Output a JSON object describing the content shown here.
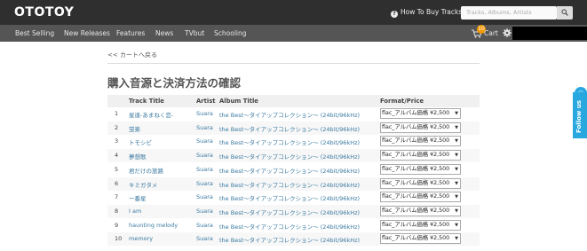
{
  "header": {
    "logo": "OTOTOY",
    "how_to_buy": "How To Buy Tracks",
    "search_placeholder": "Tracks, Albums, Artists"
  },
  "nav": {
    "items": [
      "Best Selling",
      "New Releases",
      "Features",
      "News",
      "TVbut",
      "Schooling"
    ],
    "cart_count": "10",
    "cart_label": "Cart"
  },
  "page": {
    "back_link": "<< カートへ戻る",
    "title": "購入音源と決済方法の確認"
  },
  "table": {
    "headers": {
      "track": "Track Title",
      "artist": "Artist",
      "album": "Album Title",
      "format": "Format/Price"
    },
    "rows": [
      {
        "num": "1",
        "title": "星達-あまねく恋-",
        "artist": "Suara",
        "album": "the Best〜タイアップコレクション〜 (24bit/96kHz)",
        "format": "flac_アルバム価格 ¥2,500"
      },
      {
        "num": "2",
        "title": "蛍楽",
        "artist": "Suara",
        "album": "the Best〜タイアップコレクション〜 (24bit/96kHz)",
        "format": "flac_アルバム価格 ¥2,500"
      },
      {
        "num": "3",
        "title": "トモシビ",
        "artist": "Suara",
        "album": "the Best〜タイアップコレクション〜 (24bit/96kHz)",
        "format": "flac_アルバム価格 ¥2,500"
      },
      {
        "num": "4",
        "title": "夢想歌",
        "artist": "Suara",
        "album": "the Best〜タイアップコレクション〜 (24bit/96kHz)",
        "format": "flac_アルバム価格 ¥2,500"
      },
      {
        "num": "5",
        "title": "君だけの旅路",
        "artist": "Suara",
        "album": "the Best〜タイアップコレクション〜 (24bit/96kHz)",
        "format": "flac_アルバム価格 ¥2,500"
      },
      {
        "num": "6",
        "title": "キミガタメ",
        "artist": "Suara",
        "album": "the Best〜タイアップコレクション〜 (24bit/96kHz)",
        "format": "flac_アルバム価格 ¥2,500"
      },
      {
        "num": "7",
        "title": "一番星",
        "artist": "Suara",
        "album": "the Best〜タイアップコレクション〜 (24bit/96kHz)",
        "format": "flac_アルバム価格 ¥2,500"
      },
      {
        "num": "8",
        "title": "I am",
        "artist": "Suara",
        "album": "the Best〜タイアップコレクション〜 (24bit/96kHz)",
        "format": "flac_アルバム価格 ¥2,500"
      },
      {
        "num": "9",
        "title": "haunting melody",
        "artist": "Suara",
        "album": "the Best〜タイアップコレクション〜 (24bit/96kHz)",
        "format": "flac_アルバム価格 ¥2,500"
      },
      {
        "num": "10",
        "title": "memory",
        "artist": "Suara",
        "album": "the Best〜タイアップコレクション〜 (24bit/96kHz)",
        "format": "flac_アルバム価格 ¥2,500"
      }
    ]
  },
  "follow_label": "Follow us",
  "colors": {
    "topbar": "#2f2f2f",
    "navbar": "#555555",
    "link": "#3a7aa0",
    "cart_badge": "#f39800",
    "follow": "#29a8e0"
  }
}
